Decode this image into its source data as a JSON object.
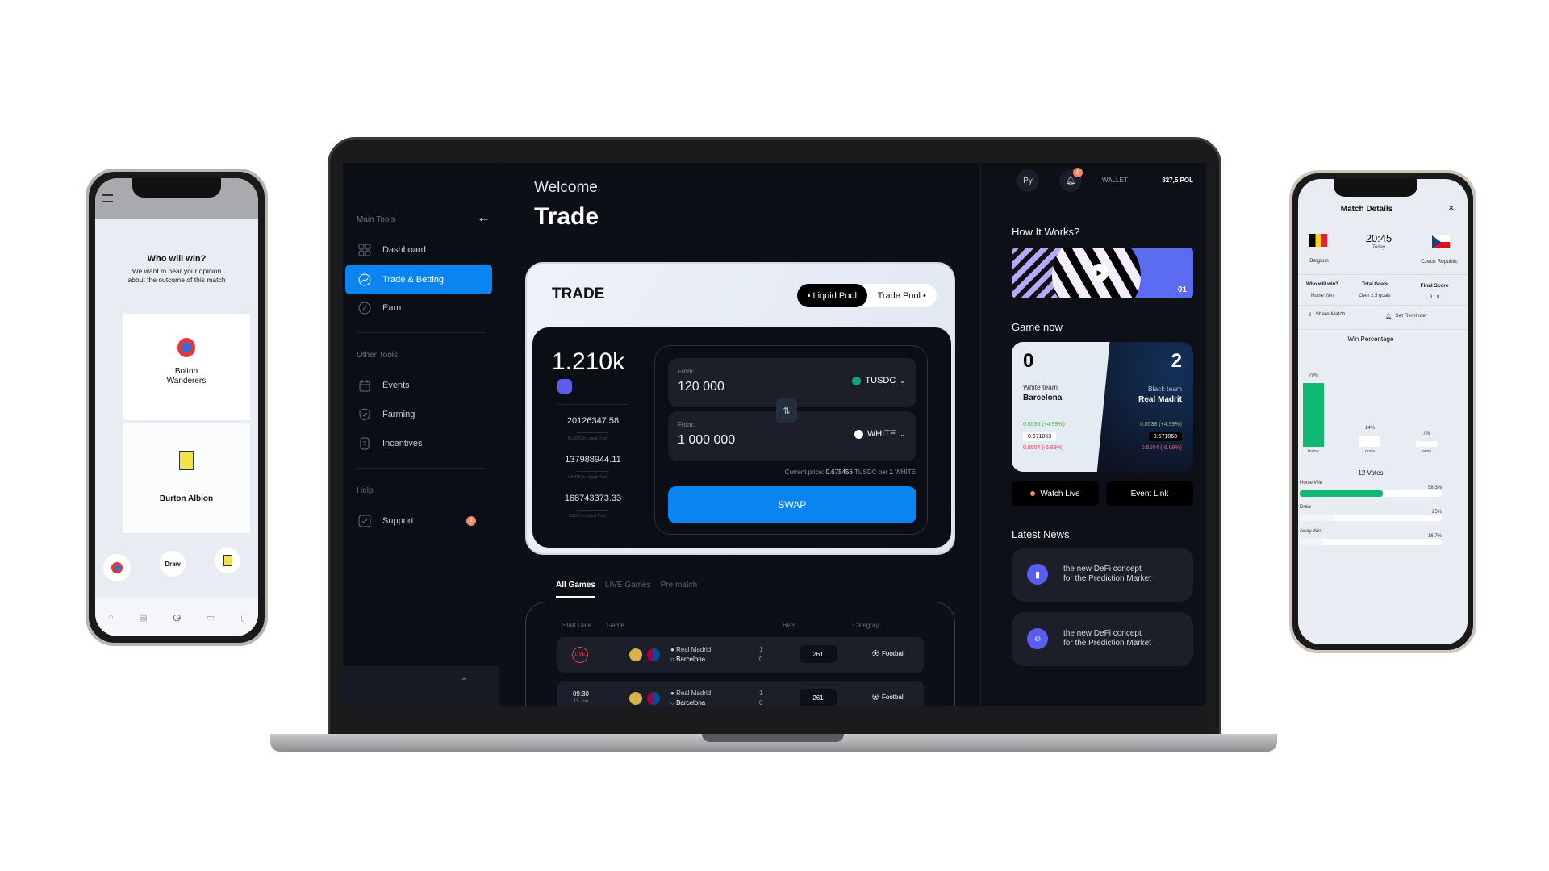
{
  "sidebar": {
    "main_tools_label": "Main Tools",
    "main_items": [
      {
        "label": "Dashboard",
        "icon": "grid-icon"
      },
      {
        "label": "Trade & Betting",
        "icon": "chart-icon",
        "active": true
      },
      {
        "label": "Earn",
        "icon": "badge-icon"
      }
    ],
    "other_tools_label": "Other Tools",
    "other_items": [
      {
        "label": "Events",
        "icon": "calendar-icon"
      },
      {
        "label": "Farming",
        "icon": "shield-icon"
      },
      {
        "label": "Incentives",
        "icon": "document-icon"
      }
    ],
    "help_label": "Help",
    "support_label": "Support",
    "support_badge": "1"
  },
  "header": {
    "welcome": "Welcome",
    "title": "Trade"
  },
  "trade": {
    "title": "TRADE",
    "pool_options": [
      "Liquid Pool",
      "Trade Pool"
    ],
    "selected_pool": "Liquid Pool",
    "total": "1.210k",
    "stats": [
      {
        "value": "20126347.58",
        "label": "BLACK in Liquid Pool"
      },
      {
        "value": "137988944.11",
        "label": "WHITE in Liquid Pool"
      },
      {
        "value": "168743373.33",
        "label": "USDC in Liquid Pool"
      }
    ],
    "from_label": "From:",
    "from1_value": "120 000",
    "from1_currency": "TUSDC",
    "from2_value": "1 000 000",
    "from2_currency": "WHITE",
    "price_prefix": "Current price:",
    "price_value": "0.675456",
    "price_suffix": "TUSDC per",
    "price_unit": "1",
    "price_unit_currency": "WHITE",
    "swap_label": "SWAP"
  },
  "games": {
    "tabs": [
      "All Games",
      "LIVE Games",
      "Pre match"
    ],
    "active_tab": "All Games",
    "columns": [
      "Start Date",
      "Game",
      "Bets",
      "Category"
    ],
    "rows": [
      {
        "start": "LIVE",
        "date": "",
        "home": "Real Madrid",
        "away": "Barcelona",
        "home_score": "1",
        "away_score": "0",
        "bets": "261",
        "category": "Football"
      },
      {
        "start": "09:30",
        "date": "15 Jun",
        "home": "Real Madrid",
        "away": "Barcelona",
        "home_score": "1",
        "away_score": "0",
        "bets": "261",
        "category": "Football"
      }
    ]
  },
  "topbar": {
    "avatar": "Py",
    "notifications": "1",
    "wallet_label": "WALLET",
    "wallet_value": "827,5 POL"
  },
  "how_it_works": {
    "title": "How It Works?",
    "video_index": "01"
  },
  "game_now": {
    "title": "Game now",
    "white": {
      "score": "0",
      "role": "White team",
      "name": "Barcelona",
      "up": "0.8538 (+4.99%)",
      "price": "0.671063",
      "down": "0.5504 (-6.69%)"
    },
    "black": {
      "score": "2",
      "role": "Black team",
      "name": "Real Madrit",
      "up": "0.8538 (+4.99%)",
      "price": "0.671063",
      "down": "0.5504 (-6.69%)"
    },
    "watch_live": "Watch Live",
    "event_link": "Event Link"
  },
  "news": {
    "title": "Latest News",
    "items": [
      {
        "text1": "the new DeFi concept",
        "text2": "for the Prediction Market",
        "icon": "bookmark-icon"
      },
      {
        "text1": "the new DeFi concept",
        "text2": "for the Prediction Market",
        "icon": "fire-icon"
      }
    ]
  },
  "left_phone": {
    "question": "Who will win?",
    "subtitle1": "We want to hear your opinion",
    "subtitle2": "about the outcome of this match",
    "team1_line1": "Bolton",
    "team1_line2": "Wanderers",
    "team2": "Burton Albion",
    "draw": "Draw"
  },
  "right_phone": {
    "title": "Match Details",
    "home": "Belgium",
    "away": "Czech Republic",
    "time": "20:45",
    "day": "Today",
    "who_label": "Who will win?",
    "who_value": "Home Win",
    "goals_label": "Total Goals",
    "goals_value": "Over 2.5 goals",
    "score_label": "Final Score",
    "score_value": "3 : 0",
    "share": "Share Match",
    "reminder": "Set Reminder",
    "chart_title": "Win Percentage",
    "votes": "12 Votes",
    "poll": [
      {
        "label": "Home Win",
        "value": 58.3,
        "text": "58.3%"
      },
      {
        "label": "Draw",
        "value": 25,
        "text": "25%"
      },
      {
        "label": "Away Win",
        "value": 16.7,
        "text": "16.7%"
      }
    ],
    "accent": "#10b874"
  },
  "chart_data": {
    "type": "bar",
    "title": "Win Percentage",
    "categories": [
      "home",
      "draw",
      "away"
    ],
    "values": [
      79,
      14,
      7
    ],
    "labels": [
      "79%",
      "14%",
      "7%"
    ]
  }
}
